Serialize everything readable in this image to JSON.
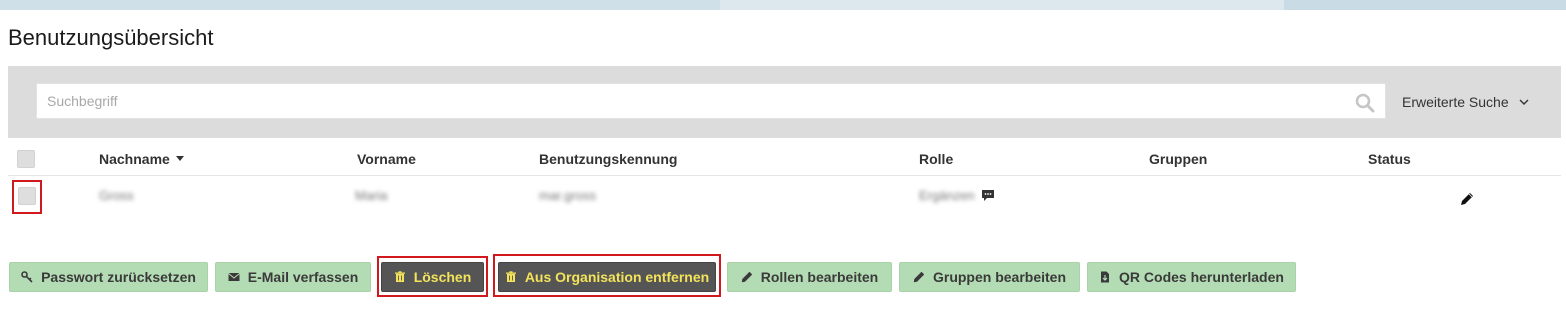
{
  "page": {
    "title": "Benutzungsübersicht"
  },
  "search": {
    "placeholder": "Suchbegriff",
    "advanced_label": "Erweiterte Suche"
  },
  "table": {
    "columns": {
      "lastname": "Nachname",
      "firstname": "Vorname",
      "username": "Benutzungskennung",
      "role": "Rolle",
      "groups": "Gruppen",
      "status": "Status"
    },
    "rows": [
      {
        "lastname": "Gross",
        "firstname": "Maria",
        "username": "mar.gross",
        "role": "Ergänzen",
        "groups": "",
        "status": ""
      }
    ]
  },
  "actions": {
    "reset_password": "Passwort zurücksetzen",
    "compose_email": "E-Mail verfassen",
    "delete": "Löschen",
    "remove_from_org": "Aus Organisation entfernen",
    "edit_roles": "Rollen bearbeiten",
    "edit_groups": "Gruppen bearbeiten",
    "download_qr": "QR Codes herunterladen"
  },
  "colors": {
    "action_green": "#b4dcb4",
    "action_dark": "#555555",
    "action_dark_text": "#f3e35a",
    "highlight_red": "#d0181d"
  },
  "icons": {
    "search": "search-icon",
    "chevron": "chevron-down-icon",
    "key": "key-icon",
    "envelope": "envelope-icon",
    "trash": "trash-icon",
    "pencil": "pencil-icon",
    "download": "file-download-icon",
    "comment": "comment-icon"
  }
}
